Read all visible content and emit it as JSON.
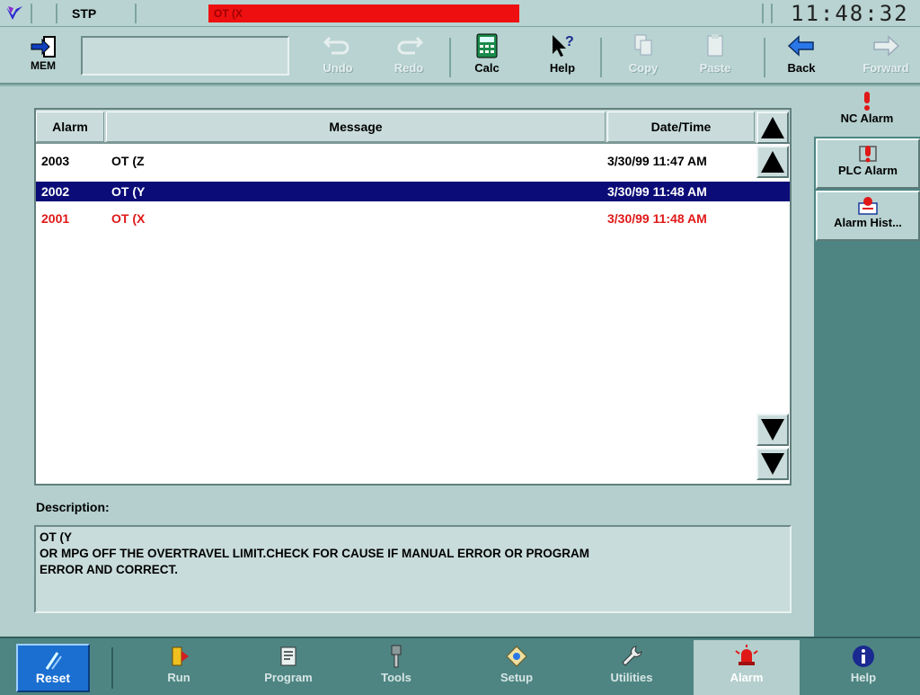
{
  "status": {
    "mode": "STP",
    "active_alarm": "OT (X",
    "clock": "11:48:32"
  },
  "toolbar": {
    "mem_label": "MEM",
    "mem_display_value": "",
    "undo_label": "Undo",
    "redo_label": "Redo",
    "calc_label": "Calc",
    "help_label": "Help",
    "copy_label": "Copy",
    "paste_label": "Paste",
    "back_label": "Back",
    "forward_label": "Forward"
  },
  "alarm_table": {
    "columns": [
      "Alarm",
      "Message",
      "Date/Time"
    ],
    "rows": [
      {
        "alarm": "2003",
        "message": "OT (Z",
        "datetime": "3/30/99 11:47 AM",
        "state": "normal"
      },
      {
        "alarm": "2002",
        "message": "OT (Y",
        "datetime": "3/30/99 11:48 AM",
        "state": "selected"
      },
      {
        "alarm": "2001",
        "message": "OT (X",
        "datetime": "3/30/99 11:48 AM",
        "state": "active"
      }
    ]
  },
  "description": {
    "label": "Description:",
    "line1": "OT (Y",
    "line2": "OR MPG OFF THE OVERTRAVEL LIMIT.CHECK FOR CAUSE IF MANUAL ERROR OR PROGRAM",
    "line3": "ERROR AND CORRECT."
  },
  "sidebar": {
    "items": [
      {
        "label": "NC Alarm",
        "icon": "exclamation-icon"
      },
      {
        "label": "PLC Alarm",
        "icon": "plc-alarm-icon"
      },
      {
        "label": "Alarm Hist...",
        "icon": "alarm-history-icon"
      }
    ]
  },
  "bottombar": {
    "reset_label": "Reset",
    "items": [
      {
        "label": "Run",
        "icon": "run-icon"
      },
      {
        "label": "Program",
        "icon": "program-icon"
      },
      {
        "label": "Tools",
        "icon": "tools-icon"
      },
      {
        "label": "Setup",
        "icon": "setup-icon"
      },
      {
        "label": "Utilities",
        "icon": "wrench-icon"
      },
      {
        "label": "Alarm",
        "icon": "beacon-icon"
      },
      {
        "label": "Help",
        "icon": "info-icon"
      }
    ]
  },
  "colors": {
    "selected_row": "#0c0c78",
    "alarm_red": "#e01818",
    "status_alarm_bar": "#ee1010",
    "reset_blue": "#1a6fd0"
  }
}
